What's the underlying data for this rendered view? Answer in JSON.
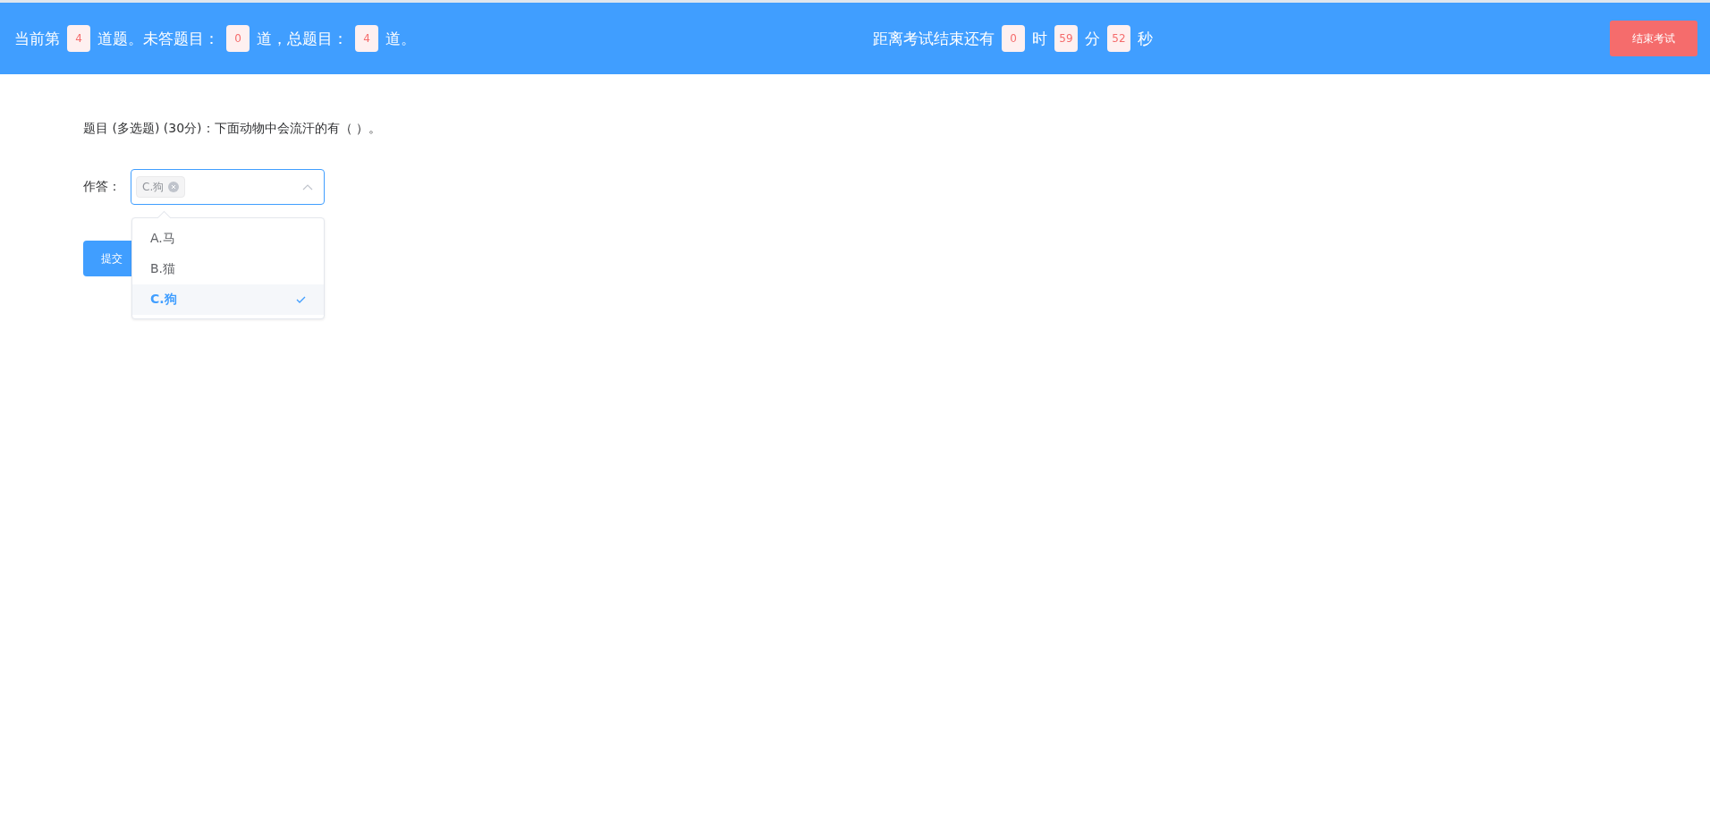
{
  "header": {
    "progress": [
      {
        "kind": "text",
        "text": "当前第"
      },
      {
        "kind": "badge",
        "text": "4"
      },
      {
        "kind": "text",
        "text": "道题。未答题目："
      },
      {
        "kind": "badge",
        "text": "0"
      },
      {
        "kind": "text",
        "text": "道，总题目："
      },
      {
        "kind": "badge",
        "text": "4"
      },
      {
        "kind": "text",
        "text": "道。"
      }
    ],
    "timer": [
      {
        "kind": "text",
        "text": "距离考试结束还有"
      },
      {
        "kind": "badge",
        "text": "0"
      },
      {
        "kind": "text",
        "text": "时"
      },
      {
        "kind": "badge",
        "text": "59"
      },
      {
        "kind": "text",
        "text": "分"
      },
      {
        "kind": "badge",
        "text": "52"
      },
      {
        "kind": "text",
        "text": "秒"
      }
    ],
    "end_button": "结束考试"
  },
  "question": "题目 (多选题) (30分)：下面动物中会流汗的有（ ）。",
  "answer": {
    "label": "作答：",
    "tags": [
      {
        "text": "C.狗"
      }
    ],
    "expanded": true,
    "options": [
      {
        "label": "A.马",
        "selected": false
      },
      {
        "label": "B.猫",
        "selected": false
      },
      {
        "label": "C.狗",
        "selected": true
      }
    ]
  },
  "submit_button": "提交"
}
